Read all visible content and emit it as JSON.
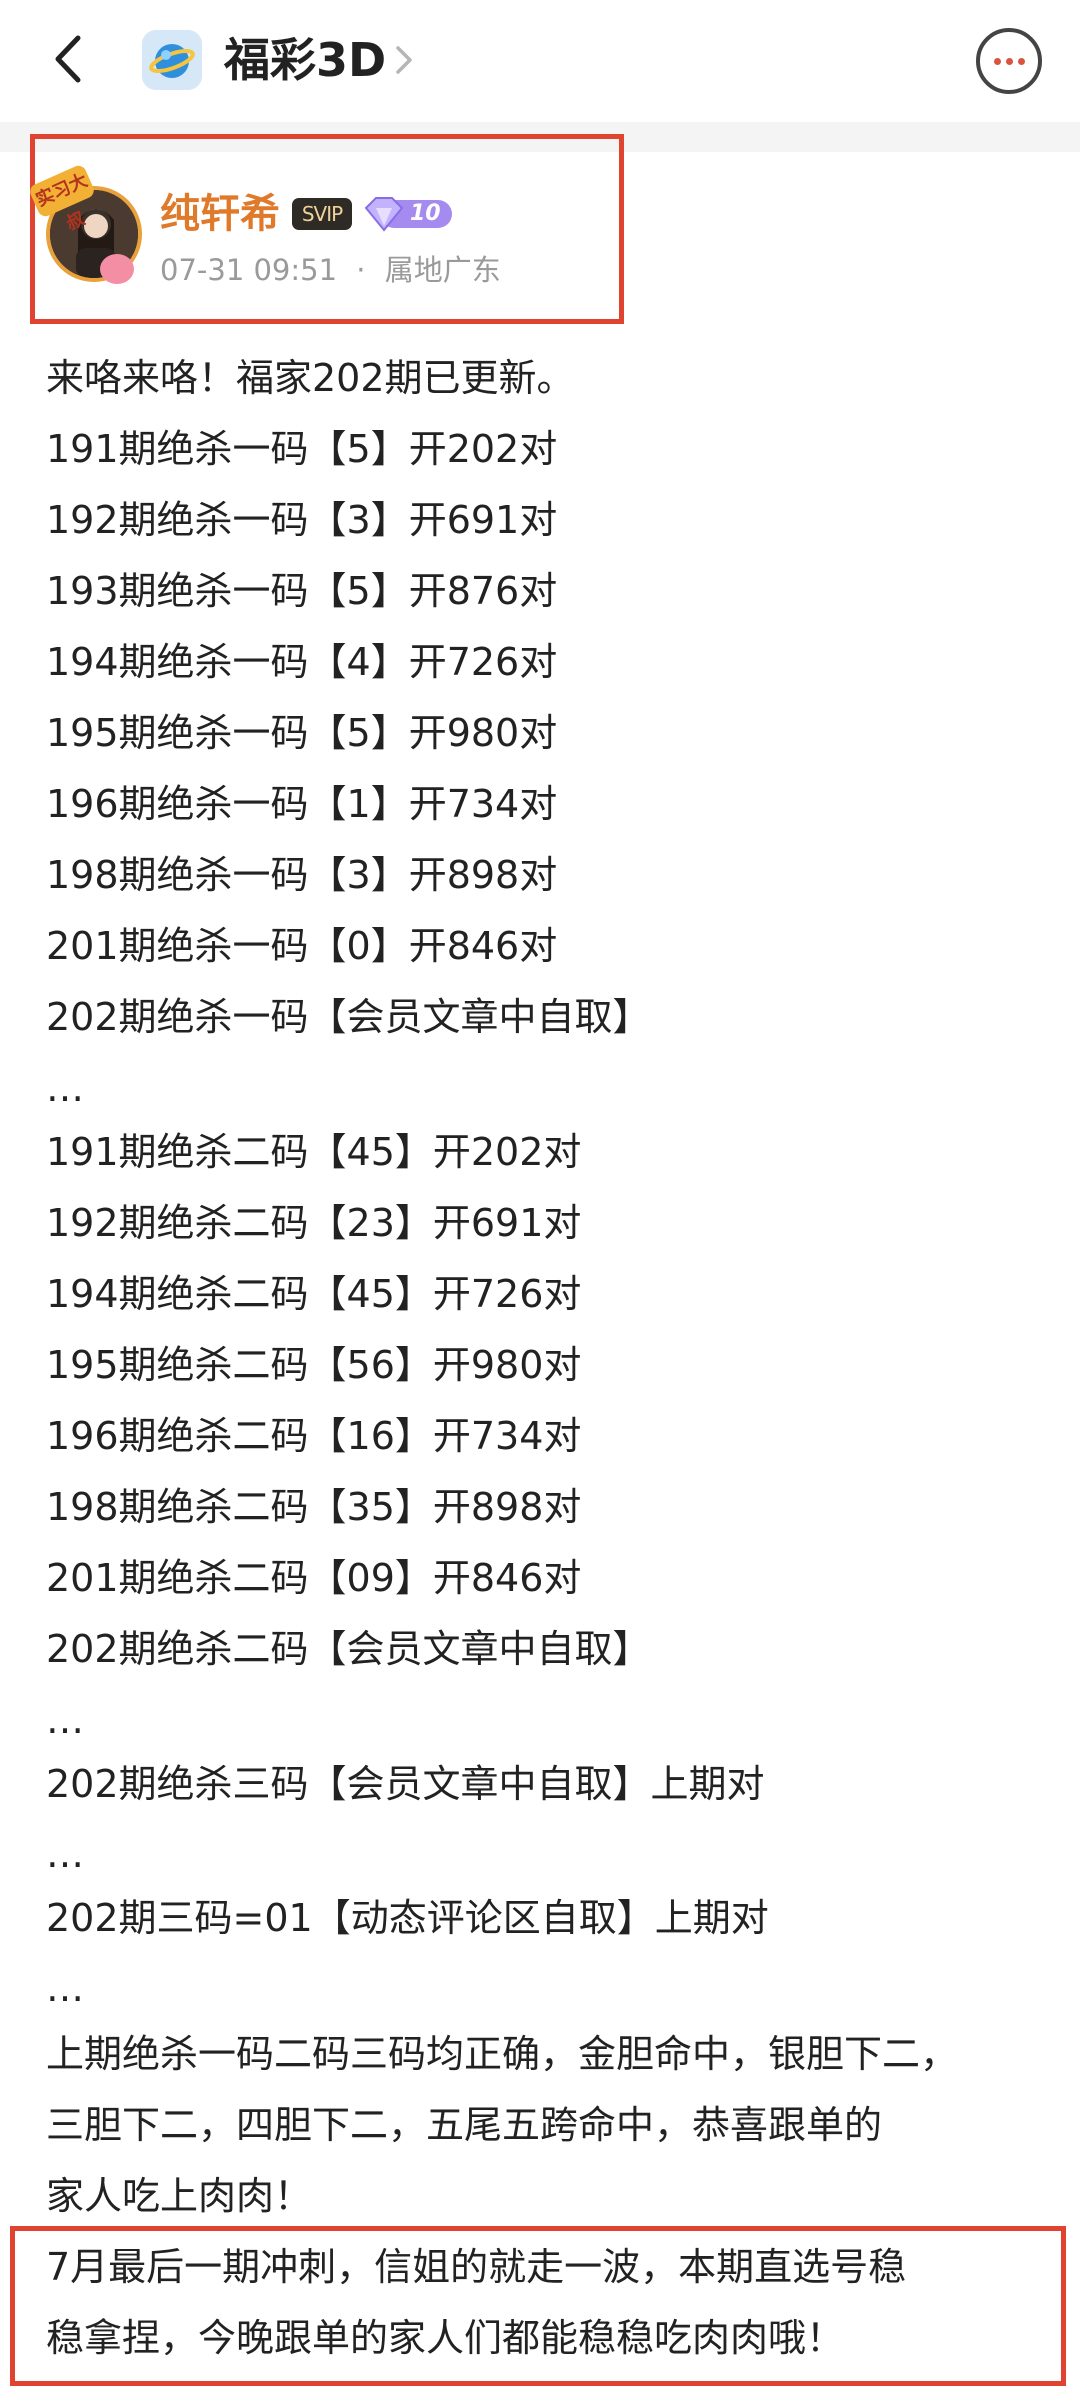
{
  "header": {
    "forum_name": "福彩3D"
  },
  "author": {
    "name": "纯轩希",
    "svip_label": "SVIP",
    "level": "10",
    "avatar_badge": "实习大叔",
    "time": "07-31 09:51",
    "separator": "·",
    "location": "属地广东"
  },
  "post": {
    "lines": [
      "来咯来咯！福家202期已更新。",
      "191期绝杀一码【5】开202对",
      "192期绝杀一码【3】开691对",
      "193期绝杀一码【5】开876对",
      "194期绝杀一码【4】开726对",
      "195期绝杀一码【5】开980对",
      "196期绝杀一码【1】开734对",
      "198期绝杀一码【3】开898对",
      "201期绝杀一码【0】开846对",
      "202期绝杀一码【会员文章中自取】",
      "…",
      "191期绝杀二码【45】开202对",
      "192期绝杀二码【23】开691对",
      "194期绝杀二码【45】开726对",
      "195期绝杀二码【56】开980对",
      "196期绝杀二码【16】开734对",
      "198期绝杀二码【35】开898对",
      "201期绝杀二码【09】开846对",
      "202期绝杀二码【会员文章中自取】",
      "…",
      "202期绝杀三码【会员文章中自取】上期对",
      "…",
      "202期三码=01【动态评论区自取】上期对",
      "…",
      "上期绝杀一码二码三码均正确，金胆命中，银胆下二，",
      "三胆下二，四胆下二，五尾五跨命中，恭喜跟单的",
      "家人吃上肉肉！",
      "7月最后一期冲刺，信姐的就走一波，本期直选号稳",
      "稳拿捏，今晚跟单的家人们都能稳稳吃肉肉哦！"
    ]
  },
  "colors": {
    "highlight_border": "#e0432f",
    "username": "#e07a2b",
    "meta_text": "#9a9a9a",
    "body_text": "#222222"
  }
}
